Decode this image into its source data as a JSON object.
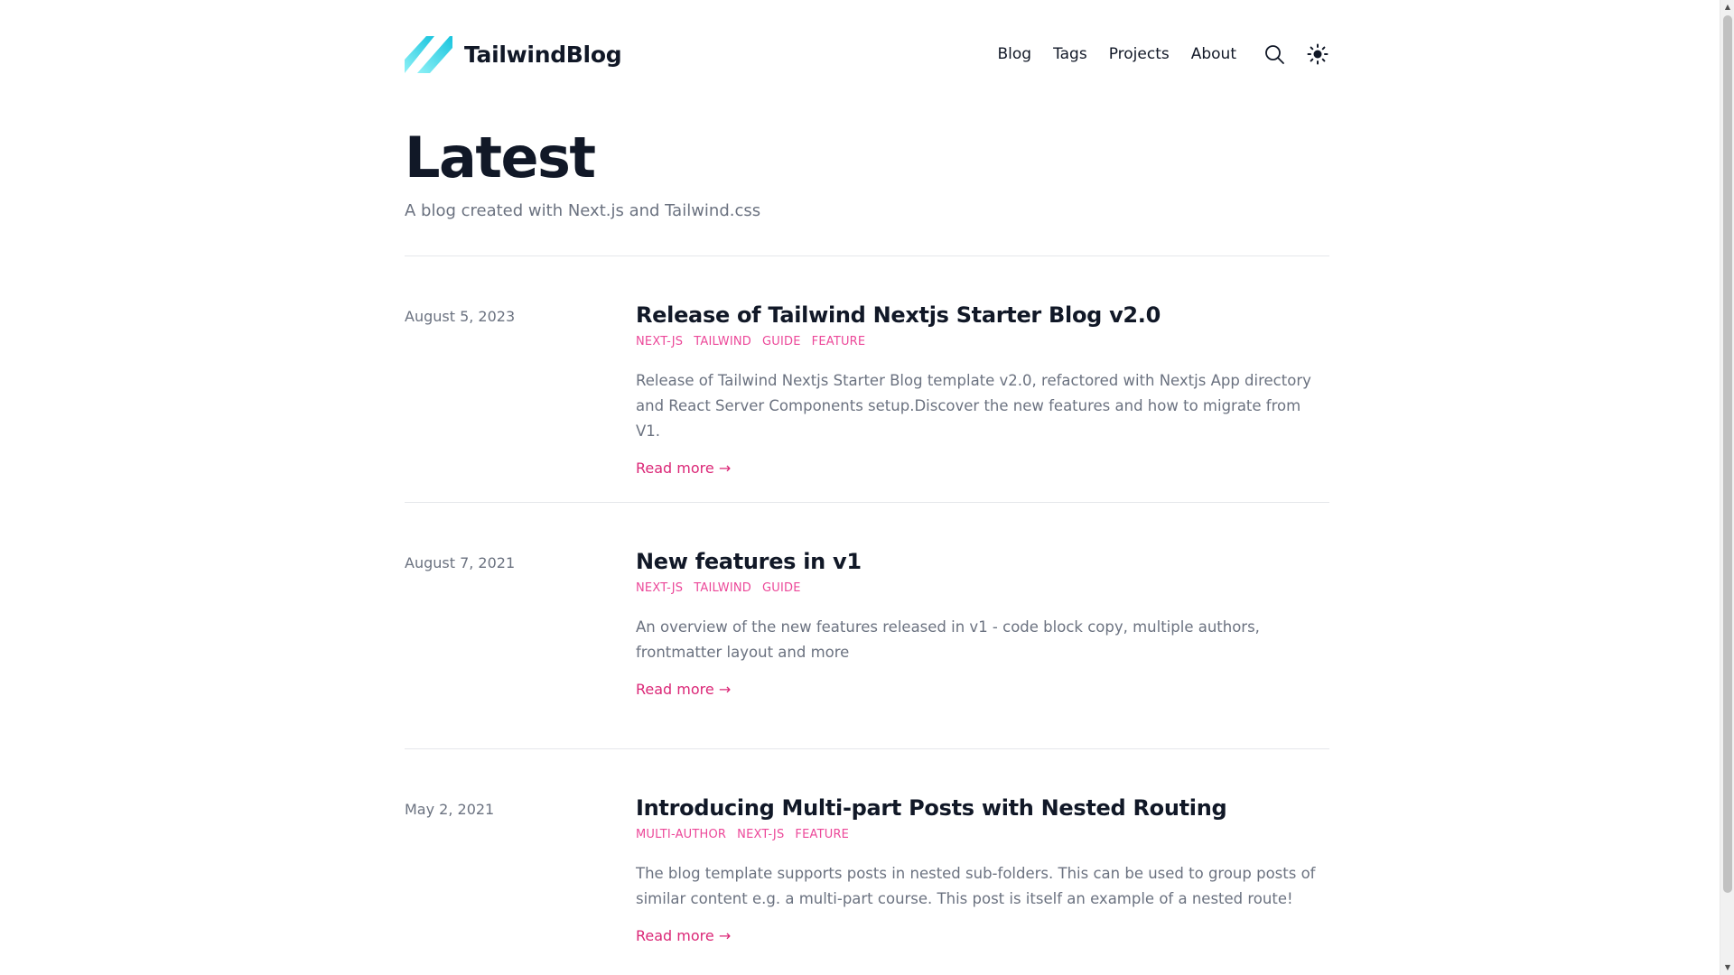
{
  "header": {
    "logo_text": "TailwindBlog",
    "nav": [
      {
        "label": "Blog"
      },
      {
        "label": "Tags"
      },
      {
        "label": "Projects"
      },
      {
        "label": "About"
      }
    ],
    "icons": {
      "search": "search-icon",
      "theme": "sun-icon"
    }
  },
  "hero": {
    "title": "Latest",
    "subtitle": "A blog created with Next.js and Tailwind.css"
  },
  "posts": [
    {
      "date": "August 5, 2023",
      "title": "Release of Tailwind Nextjs Starter Blog v2.0",
      "tags": [
        "NEXT-JS",
        "TAILWIND",
        "GUIDE",
        "FEATURE"
      ],
      "summary": "Release of Tailwind Nextjs Starter Blog template v2.0, refactored with Nextjs App directory and React Server Components setup.Discover the new features and how to migrate from V1.",
      "read_more": "Read more →"
    },
    {
      "date": "August 7, 2021",
      "title": "New features in v1",
      "tags": [
        "NEXT-JS",
        "TAILWIND",
        "GUIDE"
      ],
      "summary": "An overview of the new features released in v1 - code block copy, multiple authors, frontmatter layout and more",
      "read_more": "Read more →"
    },
    {
      "date": "May 2, 2021",
      "title": "Introducing Multi-part Posts with Nested Routing",
      "tags": [
        "MULTI-AUTHOR",
        "NEXT-JS",
        "FEATURE"
      ],
      "summary": "The blog template supports posts in nested sub-folders. This can be used to group posts of similar content e.g. a multi-part course. This post is itself an example of a nested route!",
      "read_more": "Read more →"
    }
  ],
  "colors": {
    "accent": "#ec4899",
    "accent_dark": "#db2777",
    "text": "#111827",
    "muted": "#6b7280",
    "divider": "#e5e7eb",
    "logo_light": "#60e0f0",
    "logo_dark": "#06b6d4"
  }
}
